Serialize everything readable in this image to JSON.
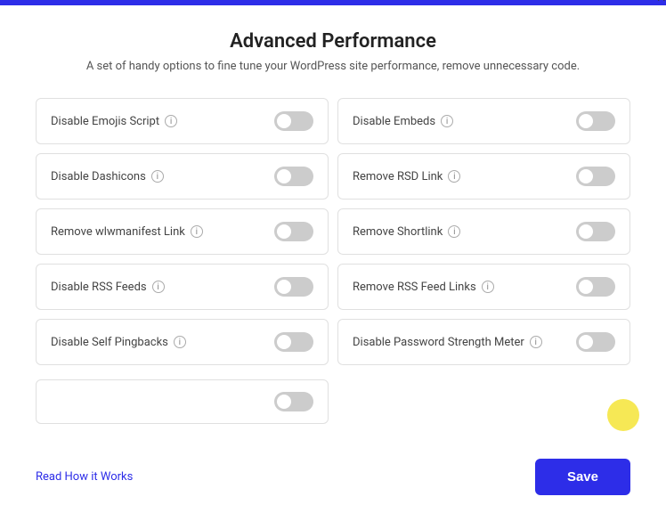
{
  "topbar": {
    "color": "#2d2de8"
  },
  "modal": {
    "title": "Advanced Performance",
    "subtitle": "A set of handy options to fine tune your WordPress site performance, remove unnecessary code.",
    "close_label": "×"
  },
  "settings": [
    {
      "id": "disable-emojis",
      "label": "Disable Emojis Script",
      "enabled": false,
      "column": "left"
    },
    {
      "id": "disable-embeds",
      "label": "Disable Embeds",
      "enabled": false,
      "column": "right"
    },
    {
      "id": "disable-dashicons",
      "label": "Disable Dashicons",
      "enabled": false,
      "column": "left"
    },
    {
      "id": "remove-rsd-link",
      "label": "Remove RSD Link",
      "enabled": false,
      "column": "right"
    },
    {
      "id": "remove-wlwmanifest",
      "label": "Remove wlwmanifest Link",
      "enabled": false,
      "column": "left"
    },
    {
      "id": "remove-shortlink",
      "label": "Remove Shortlink",
      "enabled": false,
      "column": "right"
    },
    {
      "id": "disable-rss-feeds",
      "label": "Disable RSS Feeds",
      "enabled": false,
      "column": "left"
    },
    {
      "id": "remove-rss-feed-links",
      "label": "Remove RSS Feed Links",
      "enabled": false,
      "column": "right"
    },
    {
      "id": "disable-self-pingbacks",
      "label": "Disable Self Pingbacks",
      "enabled": false,
      "column": "left"
    },
    {
      "id": "disable-password-strength",
      "label": "Disable Password Strength Meter",
      "enabled": false,
      "column": "right"
    }
  ],
  "partial_row": {
    "label": "",
    "enabled": false
  },
  "footer": {
    "read_link": "Read How it Works",
    "save_button": "Save"
  }
}
